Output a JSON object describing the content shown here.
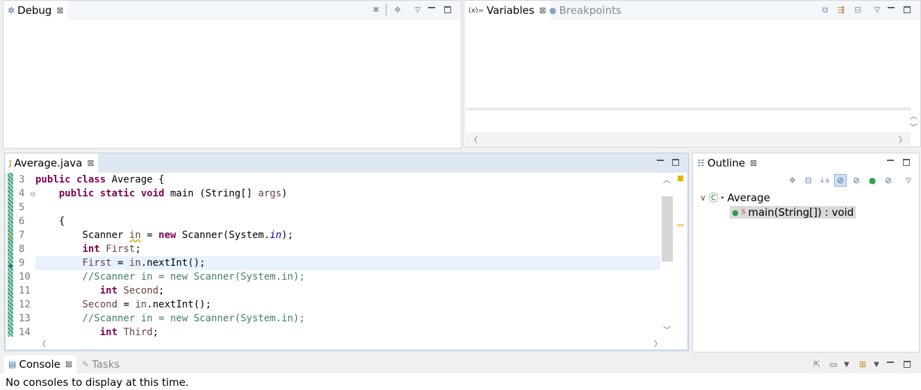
{
  "debug": {
    "tab_label": "Debug",
    "icon": "bug-icon",
    "close": "⊠"
  },
  "variables": {
    "tabs": [
      {
        "label": "Variables",
        "icon": "variables-icon",
        "prefix": "(x)="
      },
      {
        "label": "Breakpoints",
        "icon": "breakpoints-icon"
      }
    ],
    "close": "⊠"
  },
  "editor": {
    "tab_label": "Average.java",
    "close": "⊠",
    "lines": [
      {
        "n": "3",
        "tokens": [
          {
            "t": "public class ",
            "c": "kw"
          },
          {
            "t": "Average {",
            "c": ""
          }
        ]
      },
      {
        "n": "4",
        "tokens": [
          {
            "t": "    ",
            "c": ""
          },
          {
            "t": "public static void ",
            "c": "kw"
          },
          {
            "t": "main (String[] ",
            "c": ""
          },
          {
            "t": "args",
            "c": "var"
          },
          {
            "t": ")",
            "c": ""
          }
        ]
      },
      {
        "n": "5",
        "tokens": []
      },
      {
        "n": "6",
        "tokens": [
          {
            "t": "    {",
            "c": ""
          }
        ]
      },
      {
        "n": "7",
        "tokens": [
          {
            "t": "        Scanner ",
            "c": ""
          },
          {
            "t": "in",
            "c": "var warn"
          },
          {
            "t": " = ",
            "c": ""
          },
          {
            "t": "new ",
            "c": "kw"
          },
          {
            "t": "Scanner(System.",
            "c": ""
          },
          {
            "t": "in",
            "c": "fld"
          },
          {
            "t": ");",
            "c": ""
          }
        ]
      },
      {
        "n": "8",
        "tokens": [
          {
            "t": "        ",
            "c": ""
          },
          {
            "t": "int ",
            "c": "kw"
          },
          {
            "t": "First",
            "c": "var"
          },
          {
            "t": ";",
            "c": ""
          }
        ]
      },
      {
        "n": "9",
        "tokens": [
          {
            "t": "        First",
            "c": "var"
          },
          {
            "t": " = ",
            "c": ""
          },
          {
            "t": "in",
            "c": "var"
          },
          {
            "t": ".nextInt();",
            "c": ""
          }
        ],
        "highlight": true
      },
      {
        "n": "10",
        "tokens": [
          {
            "t": "        //Scanner in = new Scanner(System.in);",
            "c": "cm"
          }
        ]
      },
      {
        "n": "11",
        "tokens": [
          {
            "t": "           ",
            "c": ""
          },
          {
            "t": "int ",
            "c": "kw"
          },
          {
            "t": "Second",
            "c": "var"
          },
          {
            "t": ";",
            "c": ""
          }
        ]
      },
      {
        "n": "12",
        "tokens": [
          {
            "t": "        Second",
            "c": "var"
          },
          {
            "t": " = ",
            "c": ""
          },
          {
            "t": "in",
            "c": "var"
          },
          {
            "t": ".nextInt();",
            "c": ""
          }
        ]
      },
      {
        "n": "13",
        "tokens": [
          {
            "t": "        //Scanner in = new Scanner(System.in);",
            "c": "cm"
          }
        ]
      },
      {
        "n": "14",
        "tokens": [
          {
            "t": "           ",
            "c": ""
          },
          {
            "t": "int ",
            "c": "kw"
          },
          {
            "t": "Third",
            "c": "var"
          },
          {
            "t": ";",
            "c": ""
          }
        ]
      }
    ]
  },
  "outline": {
    "tab_label": "Outline",
    "close": "⊠",
    "class_name": "Average",
    "method_label": "main(String[]) : void",
    "method_badge": "S"
  },
  "console": {
    "tabs": [
      {
        "label": "Console",
        "icon": "console-icon"
      },
      {
        "label": "Tasks",
        "icon": "tasks-icon"
      }
    ],
    "close": "⊠",
    "message": "No consoles to display at this time."
  },
  "colors": {
    "keyword": "#7f0055",
    "comment": "#3f7f5f",
    "field": "#0000c0",
    "variable": "#6a3e3e",
    "current_line": "#e8f2fe"
  }
}
